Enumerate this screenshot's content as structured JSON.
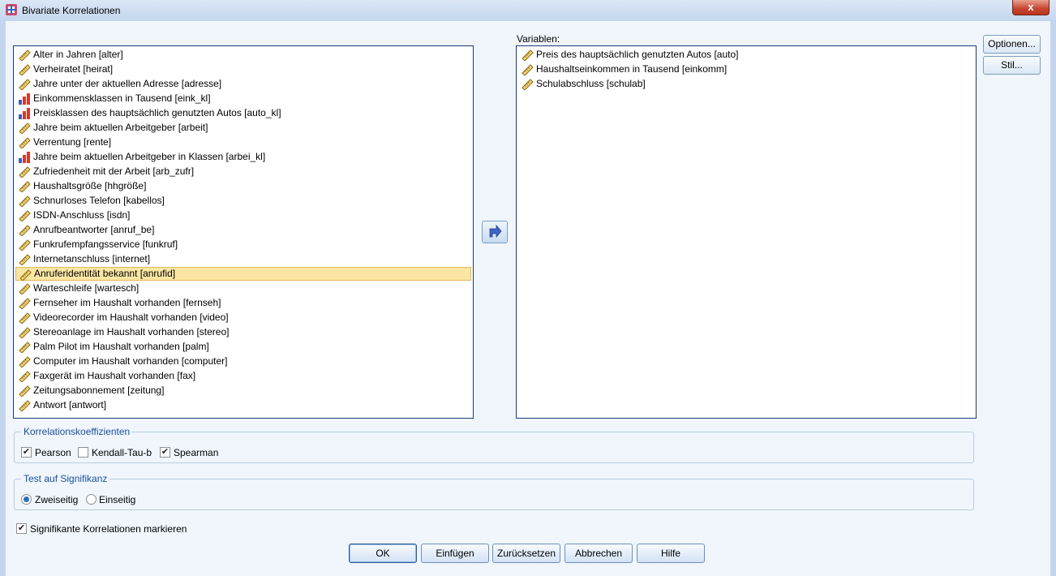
{
  "window": {
    "title": "Bivariate Korrelationen",
    "close_glyph": "x"
  },
  "source_list": {
    "items": [
      {
        "label": "Alter in Jahren [alter]",
        "icon": "scale-icon"
      },
      {
        "label": "Verheiratet [heirat]",
        "icon": "scale-icon"
      },
      {
        "label": "Jahre unter der aktuellen Adresse [adresse]",
        "icon": "scale-icon"
      },
      {
        "label": "Einkommensklassen in Tausend [eink_kl]",
        "icon": "ordinal-icon"
      },
      {
        "label": "Preisklassen des hauptsächlich genutzten Autos [auto_kl]",
        "icon": "ordinal-icon"
      },
      {
        "label": "Jahre beim aktuellen Arbeitgeber [arbeit]",
        "icon": "scale-icon"
      },
      {
        "label": "Verrentung [rente]",
        "icon": "scale-icon"
      },
      {
        "label": "Jahre beim aktuellen Arbeitgeber in Klassen [arbei_kl]",
        "icon": "ordinal-icon"
      },
      {
        "label": "Zufriedenheit mit der Arbeit [arb_zufr]",
        "icon": "scale-icon"
      },
      {
        "label": "Haushaltsgröße [hhgröße]",
        "icon": "scale-icon"
      },
      {
        "label": "Schnurloses Telefon [kabellos]",
        "icon": "scale-icon"
      },
      {
        "label": "ISDN-Anschluss [isdn]",
        "icon": "scale-icon"
      },
      {
        "label": "Anrufbeantworter [anruf_be]",
        "icon": "scale-icon"
      },
      {
        "label": "Funkrufempfangsservice [funkruf]",
        "icon": "scale-icon"
      },
      {
        "label": "Internetanschluss [internet]",
        "icon": "scale-icon"
      },
      {
        "label": "Anruferidentität bekannt [anrufid]",
        "icon": "scale-icon",
        "selected": true
      },
      {
        "label": "Warteschleife [wartesch]",
        "icon": "scale-icon"
      },
      {
        "label": "Fernseher im Haushalt vorhanden [fernseh]",
        "icon": "scale-icon"
      },
      {
        "label": "Videorecorder im Haushalt vorhanden [video]",
        "icon": "scale-icon"
      },
      {
        "label": "Stereoanlage im Haushalt vorhanden [stereo]",
        "icon": "scale-icon"
      },
      {
        "label": "Palm Pilot im Haushalt vorhanden [palm]",
        "icon": "scale-icon"
      },
      {
        "label": "Computer im Haushalt vorhanden [computer]",
        "icon": "scale-icon"
      },
      {
        "label": "Faxgerät im Haushalt vorhanden [fax]",
        "icon": "scale-icon"
      },
      {
        "label": "Zeitungsabonnement [zeitung]",
        "icon": "scale-icon"
      },
      {
        "label": "Antwort [antwort]",
        "icon": "scale-icon"
      }
    ]
  },
  "target_list": {
    "label": "Variablen:",
    "items": [
      {
        "label": "Preis des hauptsächlich genutzten Autos [auto]",
        "icon": "scale-icon"
      },
      {
        "label": "Haushaltseinkommen in Tausend [einkomm]",
        "icon": "scale-icon"
      },
      {
        "label": "Schulabschluss [schulab]",
        "icon": "scale-icon"
      }
    ]
  },
  "side_buttons": {
    "options": "Optionen...",
    "style": "Stil..."
  },
  "correlation_group": {
    "legend": "Korrelationskoeffizienten",
    "pearson": {
      "label": "Pearson",
      "checked": true
    },
    "kendall": {
      "label": "Kendall-Tau-b",
      "checked": false
    },
    "spearman": {
      "label": "Spearman",
      "checked": true
    }
  },
  "test_group": {
    "legend": "Test auf Signifikanz",
    "two_sided": {
      "label": "Zweiseitig",
      "selected": true
    },
    "one_sided": {
      "label": "Einseitig",
      "selected": false
    }
  },
  "flag_significant": {
    "label": "Signifikante Korrelationen markieren",
    "checked": true
  },
  "buttons": {
    "ok": "OK",
    "paste": "Einfügen",
    "reset": "Zurücksetzen",
    "cancel": "Abbrechen",
    "help": "Hilfe"
  },
  "colors": {
    "selection": "#fbe6a3",
    "list_border": "#1c3a79",
    "group_legend": "#1a4f9a",
    "close_button": "#c7442f"
  }
}
